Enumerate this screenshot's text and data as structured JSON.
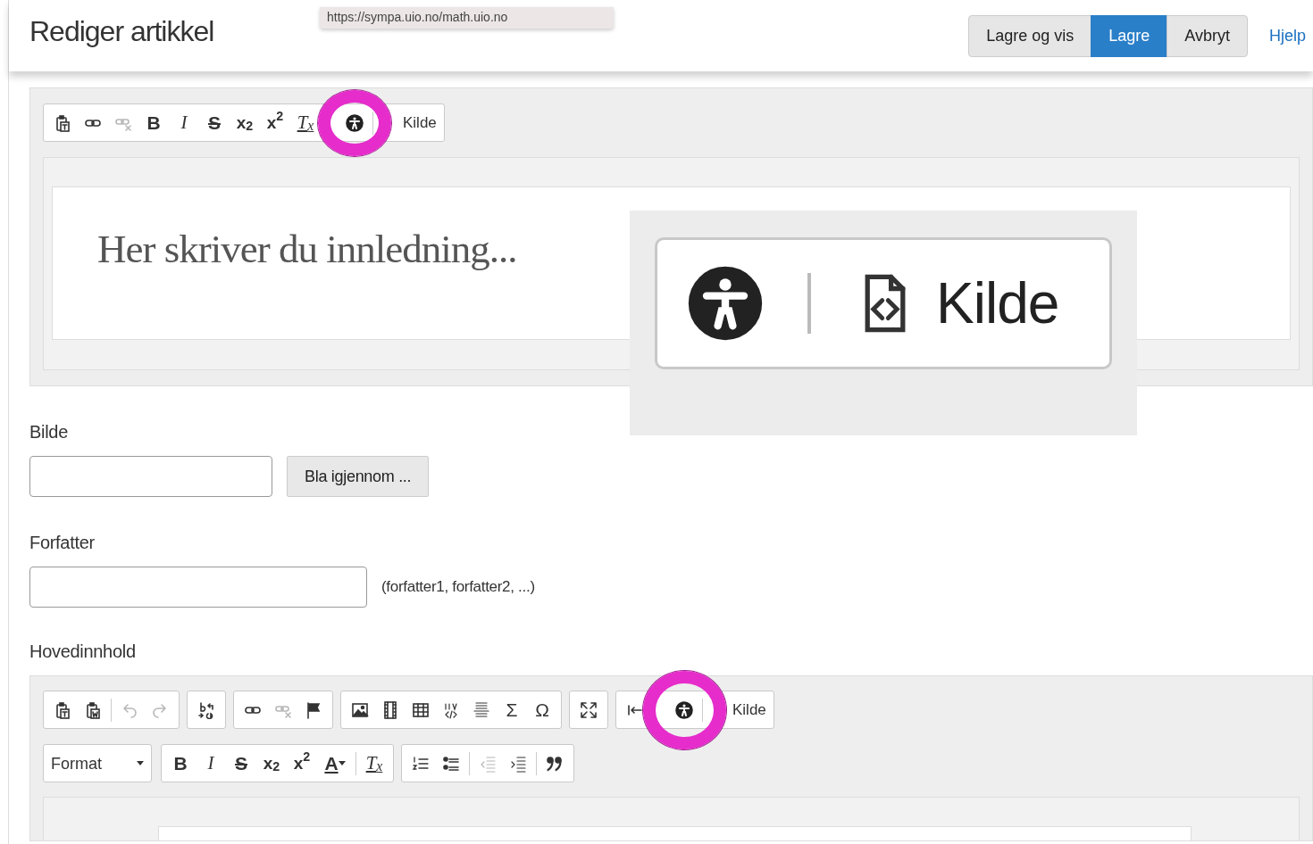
{
  "header": {
    "title": "Rediger artikkel",
    "tooltip": "https://sympa.uio.no/math.uio.no",
    "buttons": [
      {
        "label": "Lagre og vis",
        "selected": false
      },
      {
        "label": "Lagre",
        "selected": true
      },
      {
        "label": "Avbryt",
        "selected": false
      }
    ],
    "help_link": "Hjelp"
  },
  "intro_editor": {
    "toolbar": [
      {
        "kind": "paste-text",
        "disabled": false
      },
      {
        "kind": "link",
        "disabled": false
      },
      {
        "kind": "unlink",
        "disabled": true
      },
      {
        "kind": "bold",
        "label": "B",
        "disabled": false
      },
      {
        "kind": "italic",
        "label": "I",
        "disabled": false
      },
      {
        "kind": "strike",
        "label": "S",
        "disabled": false
      },
      {
        "kind": "subscript",
        "label": "x$_{2}$",
        "disabled": false
      },
      {
        "kind": "superscript",
        "label": "x$^{2}$",
        "disabled": false
      },
      {
        "kind": "remove-format",
        "label": "T$_{x}$",
        "disabled": false
      },
      {
        "kind": "a11y",
        "disabled": false,
        "divider_before": true
      },
      {
        "kind": "source",
        "label": "Kilde",
        "disabled": false,
        "divider_before": true
      }
    ],
    "placeholder": "Her skriver du innledning..."
  },
  "callout": {
    "source_button": "Kilde"
  },
  "fields": [
    {
      "label": "Bilde",
      "kind": "file",
      "button": "Bla igjennom ..."
    },
    {
      "label": "Forfatter",
      "kind": "text",
      "hint": "(forfatter1, forfatter2, ...)"
    }
  ],
  "main_editor": {
    "label": "Hovedinnhold",
    "rows": [
      [
        [
          {
            "kind": "paste-text",
            "disabled": false
          },
          {
            "kind": "paste-word",
            "disabled": false
          },
          {
            "kind": "undo",
            "disabled": true,
            "divider_before": true
          },
          {
            "kind": "redo",
            "disabled": true
          }
        ],
        [
          {
            "kind": "find-replace",
            "disabled": false
          }
        ],
        [
          {
            "kind": "link",
            "disabled": false
          },
          {
            "kind": "unlink",
            "disabled": true
          },
          {
            "kind": "anchor",
            "disabled": false
          }
        ],
        [
          {
            "kind": "image",
            "disabled": false
          },
          {
            "kind": "video",
            "disabled": false
          },
          {
            "kind": "table",
            "disabled": false
          },
          {
            "kind": "div",
            "disabled": false
          },
          {
            "kind": "hr",
            "disabled": false
          },
          {
            "kind": "glyph",
            "label": "Σ",
            "disabled": false
          },
          {
            "kind": "glyph",
            "label": "Ω",
            "disabled": false
          }
        ],
        [
          {
            "kind": "maximize",
            "disabled": false
          }
        ],
        [
          {
            "kind": "bidi",
            "disabled": false
          },
          {
            "kind": "a11y",
            "disabled": false,
            "divider_before": true
          },
          {
            "kind": "source",
            "label": "Kilde",
            "disabled": false,
            "divider_before": true
          }
        ]
      ],
      [
        [
          {
            "kind": "dropdown",
            "label": "Format",
            "disabled": false
          }
        ],
        [
          {
            "kind": "bold",
            "label": "B",
            "disabled": false
          },
          {
            "kind": "italic",
            "label": "I",
            "disabled": false
          },
          {
            "kind": "strike",
            "label": "S",
            "disabled": false
          },
          {
            "kind": "subscript",
            "label": "x$_{2}$",
            "disabled": false
          },
          {
            "kind": "superscript",
            "label": "x$^{2}$",
            "disabled": false
          },
          {
            "kind": "text-color",
            "label": "A",
            "disabled": false
          },
          {
            "kind": "remove-format",
            "label": "T$_{x}$",
            "disabled": false,
            "divider_before": true
          }
        ],
        [
          {
            "kind": "numbered-list",
            "disabled": false
          },
          {
            "kind": "bulleted-list",
            "disabled": false
          },
          {
            "kind": "outdent",
            "disabled": true,
            "divider_before": true
          },
          {
            "kind": "indent",
            "disabled": false
          },
          {
            "kind": "blockquote",
            "disabled": false,
            "divider_before": true
          }
        ]
      ]
    ]
  }
}
